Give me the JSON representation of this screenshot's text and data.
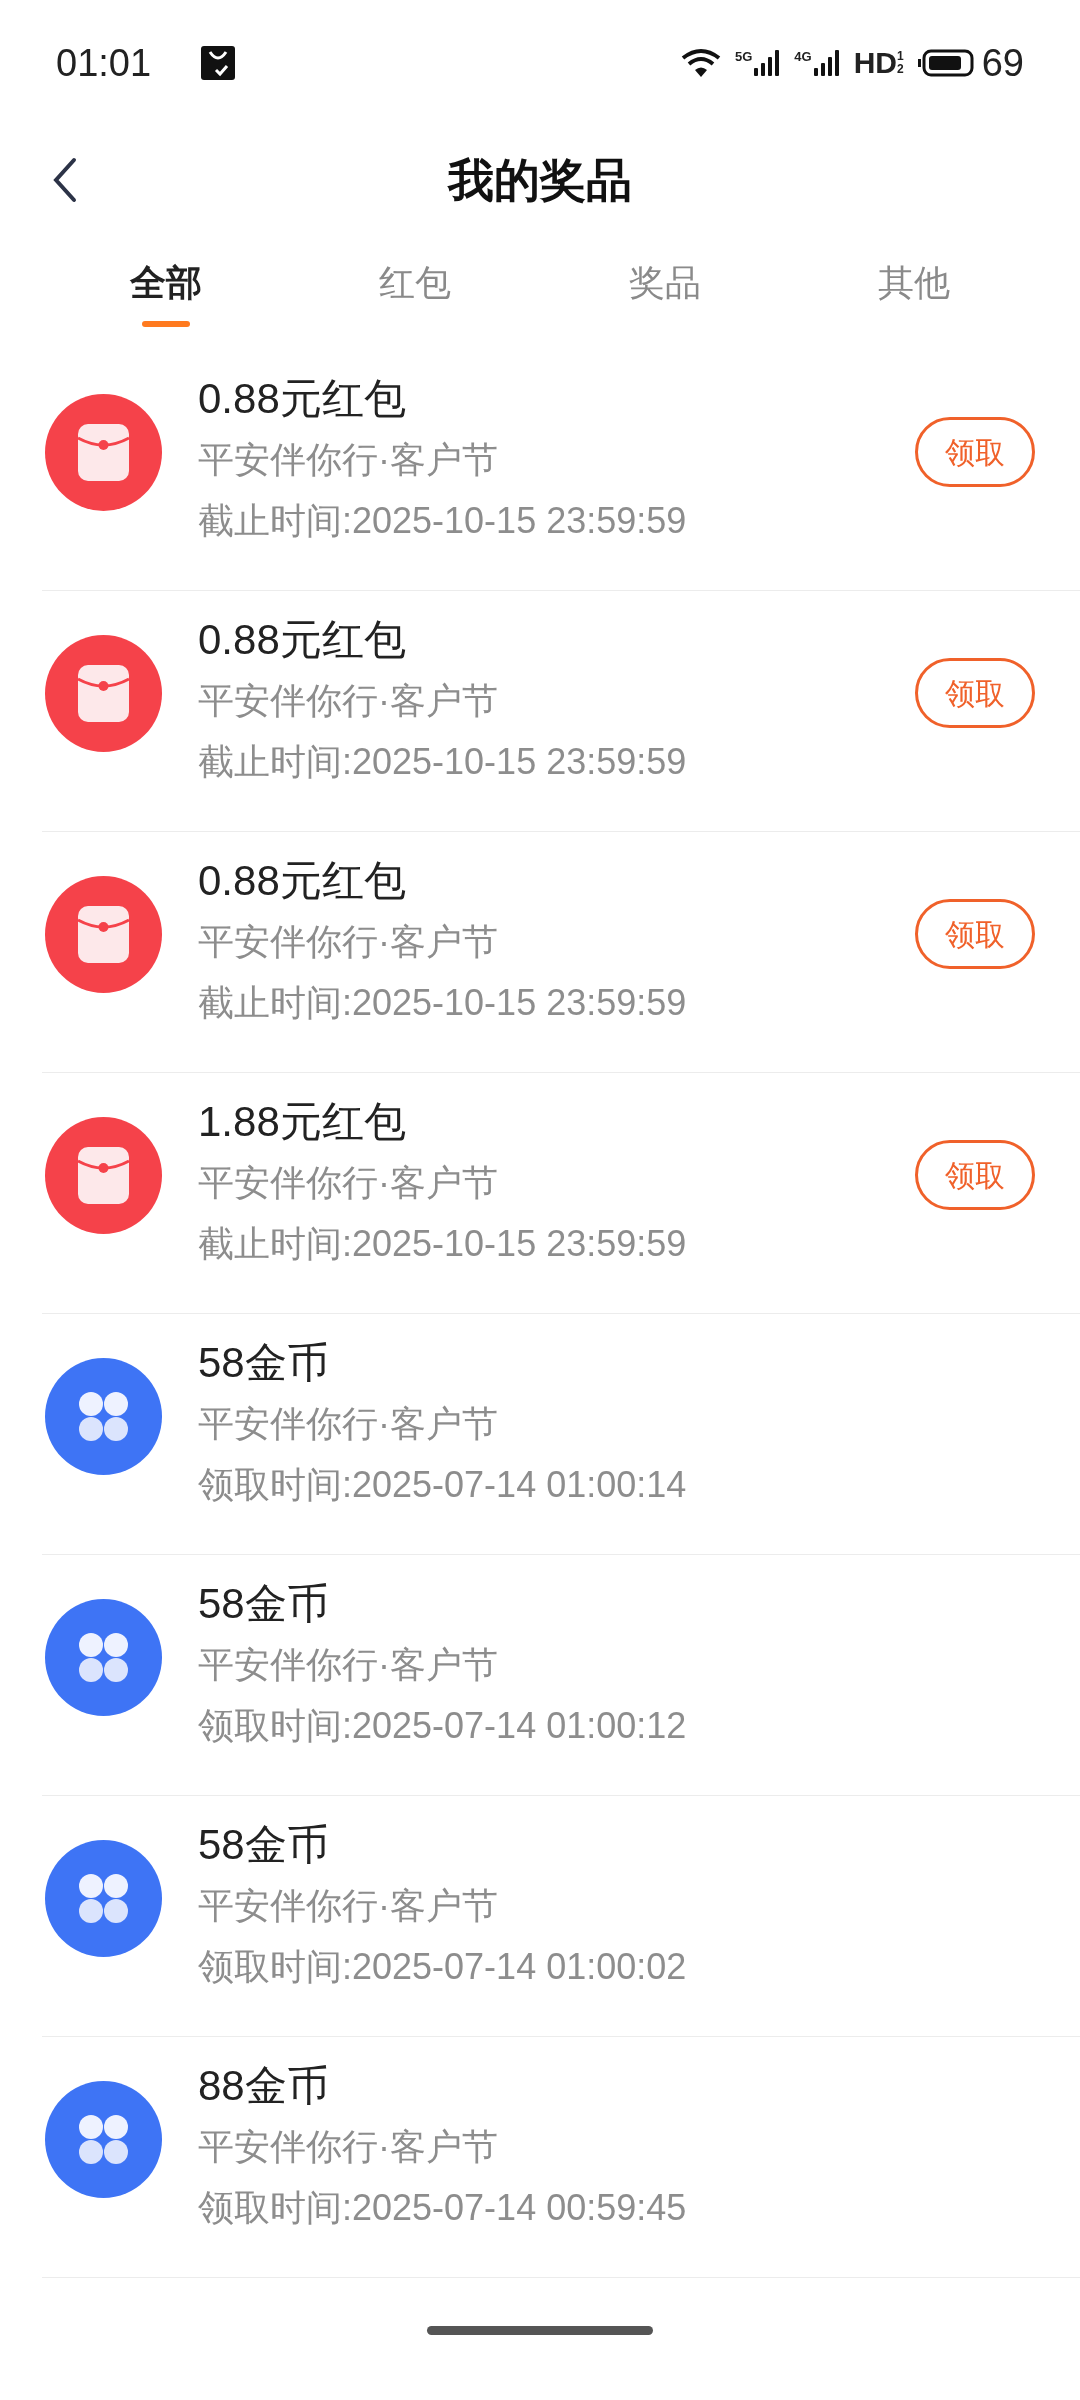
{
  "status_bar": {
    "time": "01:01",
    "signal_labels": [
      "5G",
      "4G"
    ],
    "hd": "HD",
    "hd_slots": [
      "1",
      "2"
    ],
    "battery": "69"
  },
  "header": {
    "title": "我的奖品"
  },
  "tabs": [
    {
      "label": "全部",
      "selected": true
    },
    {
      "label": "红包",
      "selected": false
    },
    {
      "label": "奖品",
      "selected": false
    },
    {
      "label": "其他",
      "selected": false
    }
  ],
  "prizes": [
    {
      "kind": "red_packet",
      "title": "0.88元红包",
      "source": "平安伴你行·客户节",
      "time": "截止时间:2025-10-15 23:59:59",
      "action": "领取"
    },
    {
      "kind": "red_packet",
      "title": "0.88元红包",
      "source": "平安伴你行·客户节",
      "time": "截止时间:2025-10-15 23:59:59",
      "action": "领取"
    },
    {
      "kind": "red_packet",
      "title": "0.88元红包",
      "source": "平安伴你行·客户节",
      "time": "截止时间:2025-10-15 23:59:59",
      "action": "领取"
    },
    {
      "kind": "red_packet",
      "title": "1.88元红包",
      "source": "平安伴你行·客户节",
      "time": "截止时间:2025-10-15 23:59:59",
      "action": "领取"
    },
    {
      "kind": "coins",
      "title": "58金币",
      "source": "平安伴你行·客户节",
      "time": "领取时间:2025-07-14 01:00:14"
    },
    {
      "kind": "coins",
      "title": "58金币",
      "source": "平安伴你行·客户节",
      "time": "领取时间:2025-07-14 01:00:12"
    },
    {
      "kind": "coins",
      "title": "58金币",
      "source": "平安伴你行·客户节",
      "time": "领取时间:2025-07-14 01:00:02"
    },
    {
      "kind": "coins",
      "title": "88金币",
      "source": "平安伴你行·客户节",
      "time": "领取时间:2025-07-14 00:59:45"
    }
  ]
}
